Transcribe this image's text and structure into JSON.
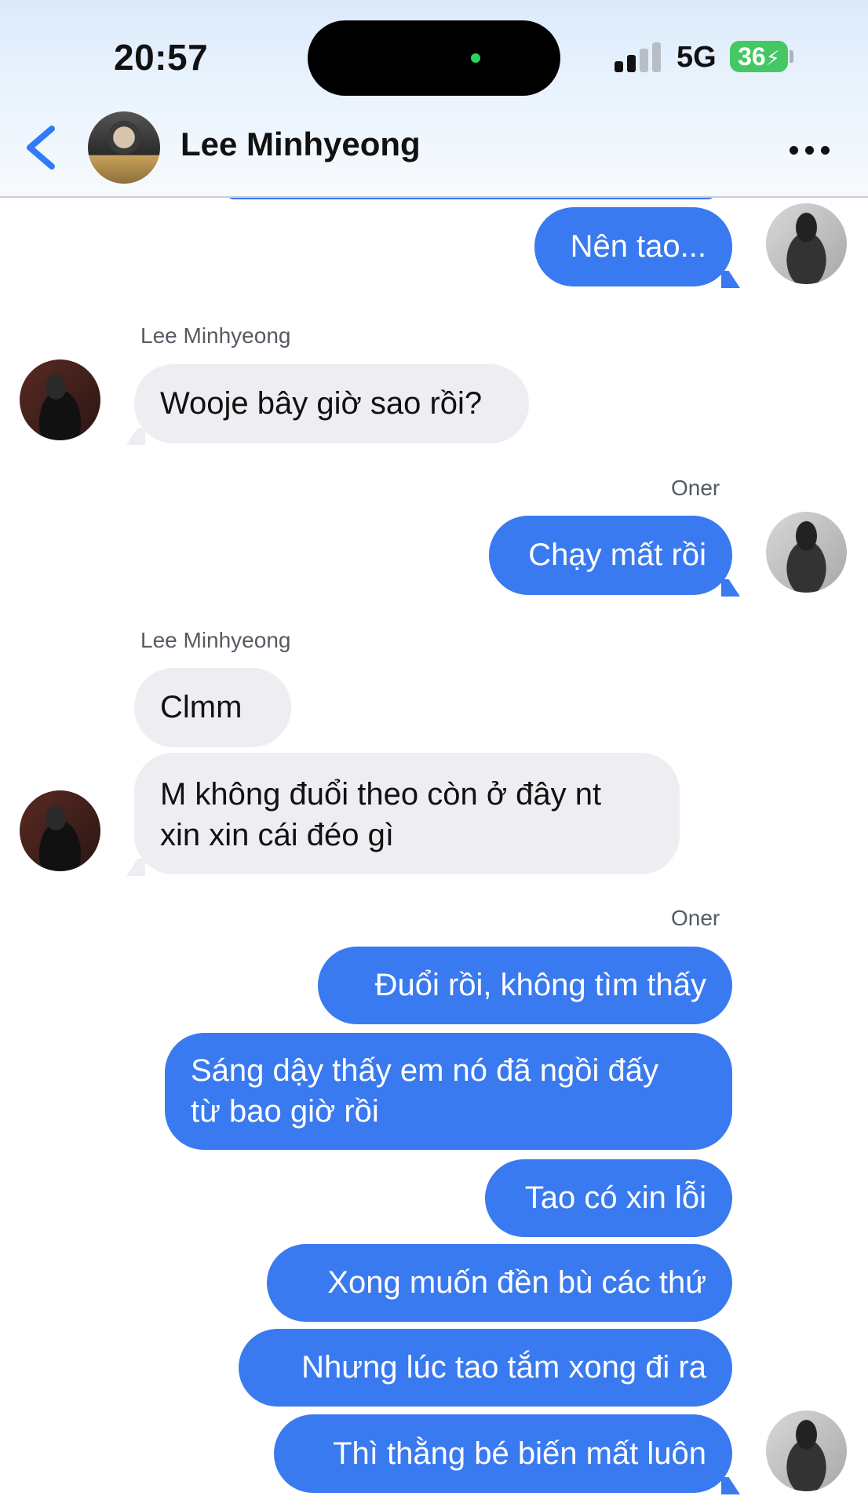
{
  "status_bar": {
    "time": "20:57",
    "network": "5G",
    "battery": "36"
  },
  "header": {
    "contact_name": "Lee Minhyeong"
  },
  "messages": [
    {
      "from": "me",
      "text": "Nên tao..."
    },
    {
      "from": "them",
      "sender": "Lee Minhyeong",
      "text": "Wooje bây giờ sao rồi?"
    },
    {
      "from": "me",
      "sender": "Oner",
      "text": "Chạy mất rồi"
    },
    {
      "from": "them",
      "sender": "Lee Minhyeong",
      "text": "Clmm"
    },
    {
      "from": "them",
      "lines": [
        "M không đuổi theo còn ở đây nt",
        "xin xin cái đéo gì"
      ]
    },
    {
      "from": "me",
      "sender": "Oner",
      "text": "Đuổi rồi, không tìm thấy"
    },
    {
      "from": "me",
      "lines": [
        "Sáng dậy thấy em nó đã ngồi đấy",
        "từ bao giờ rồi"
      ]
    },
    {
      "from": "me",
      "text": "Tao có xin lỗi"
    },
    {
      "from": "me",
      "text": "Xong muốn đền bù các thứ"
    },
    {
      "from": "me",
      "text": "Nhưng lúc tao tắm xong đi ra"
    },
    {
      "from": "me",
      "text": "Thì thằng bé biến mất luôn"
    }
  ],
  "colors": {
    "outgoing_bubble": "#3a7af0",
    "incoming_bubble": "#eeeef2",
    "accent": "#2f7cf6"
  },
  "icons": {
    "back": "chevron-left-icon",
    "more": "more-horizontal-icon",
    "battery": "battery-charging-icon",
    "signal": "signal-bars-icon"
  }
}
